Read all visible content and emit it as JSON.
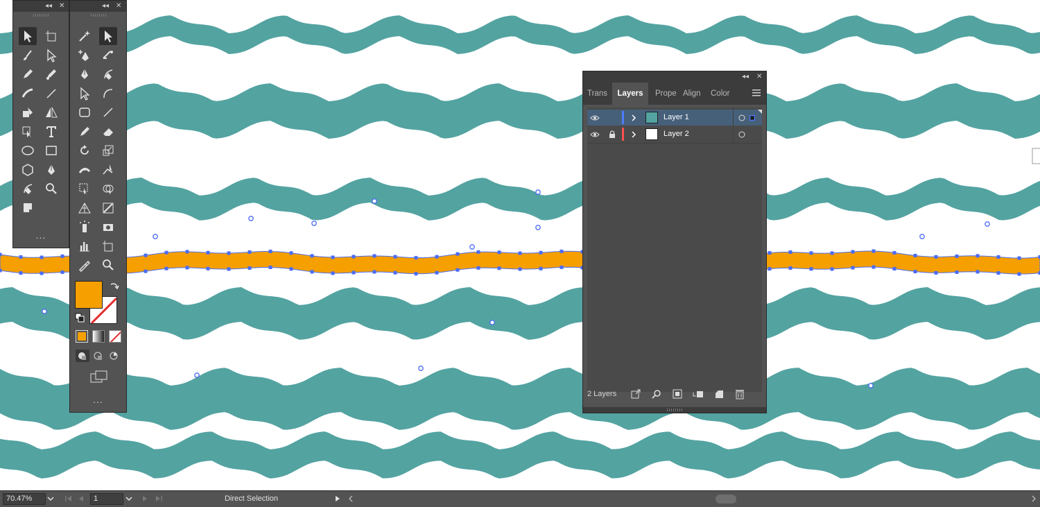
{
  "canvas": {
    "colors": {
      "wave": "#53a3a1",
      "stroke": "#f5a000",
      "anchor": "#4b6cf5",
      "background": "#ffffff"
    }
  },
  "toolbar_left": {
    "tools": [
      {
        "name": "selection-tool-icon",
        "active": true
      },
      {
        "name": "artboard-tool-icon"
      },
      {
        "name": "paintbrush-tool-icon"
      },
      {
        "name": "direct-selection-tool-icon"
      },
      {
        "name": "pencil-tool-icon"
      },
      {
        "name": "blob-brush-tool-icon"
      },
      {
        "name": "shaper-tool-icon"
      },
      {
        "name": "line-segment-tool-icon"
      },
      {
        "name": "live-paint-tool-icon"
      },
      {
        "name": "reflect-tool-icon"
      },
      {
        "name": "live-paint-selection-icon"
      },
      {
        "name": "type-tool-icon"
      },
      {
        "name": "ellipse-tool-icon"
      },
      {
        "name": "rectangle-tool-icon"
      },
      {
        "name": "polygon-tool-icon"
      },
      {
        "name": "pen-tool-icon"
      },
      {
        "name": "curvature-tool-icon"
      },
      {
        "name": "zoom-tool-icon"
      },
      {
        "name": "flag-tool-icon"
      }
    ],
    "more_label": "..."
  },
  "toolbar_right": {
    "tools": [
      {
        "name": "magic-wand-tool-icon"
      },
      {
        "name": "selection-tool-icon",
        "active": true
      },
      {
        "name": "add-anchor-point-tool-icon"
      },
      {
        "name": "anchor-point-tool-icon"
      },
      {
        "name": "pen-tool-icon"
      },
      {
        "name": "curvature-tool-icon"
      },
      {
        "name": "direct-selection-tool-icon"
      },
      {
        "name": "arc-tool-icon"
      },
      {
        "name": "rounded-rectangle-tool-icon"
      },
      {
        "name": "line-tool-icon"
      },
      {
        "name": "pencil-tool-icon"
      },
      {
        "name": "eraser-tool-icon"
      },
      {
        "name": "rotate-tool-icon"
      },
      {
        "name": "scale-tool-icon"
      },
      {
        "name": "width-tool-icon"
      },
      {
        "name": "puppet-warp-tool-icon"
      },
      {
        "name": "free-transform-tool-icon"
      },
      {
        "name": "shape-builder-tool-icon"
      },
      {
        "name": "perspective-grid-tool-icon"
      },
      {
        "name": "gradient-tool-icon"
      },
      {
        "name": "symbol-sprayer-tool-icon"
      },
      {
        "name": "camera-tool-icon"
      },
      {
        "name": "column-graph-tool-icon"
      },
      {
        "name": "artboard-tool-icon"
      },
      {
        "name": "eyedropper-tool-icon"
      },
      {
        "name": "zoom-tool-icon"
      }
    ],
    "fill_color": "#f5a000",
    "more_label": "..."
  },
  "layers_panel": {
    "tabs": [
      {
        "label": "Trans"
      },
      {
        "label": "Layers",
        "active": true
      },
      {
        "label": "Prope"
      },
      {
        "label": "Align"
      },
      {
        "label": "Color"
      }
    ],
    "layers": [
      {
        "name": "Layer 1",
        "color": "#4f7cff",
        "selected": true,
        "locked": false,
        "thumb": "#53a3a1"
      },
      {
        "name": "Layer 2",
        "color": "#ff4f4f",
        "selected": false,
        "locked": true,
        "thumb": "#ffffff"
      }
    ],
    "footer": {
      "count": "2 Layers"
    }
  },
  "statusbar": {
    "zoom": "70.47%",
    "artboard": "1",
    "tool": "Direct Selection"
  }
}
